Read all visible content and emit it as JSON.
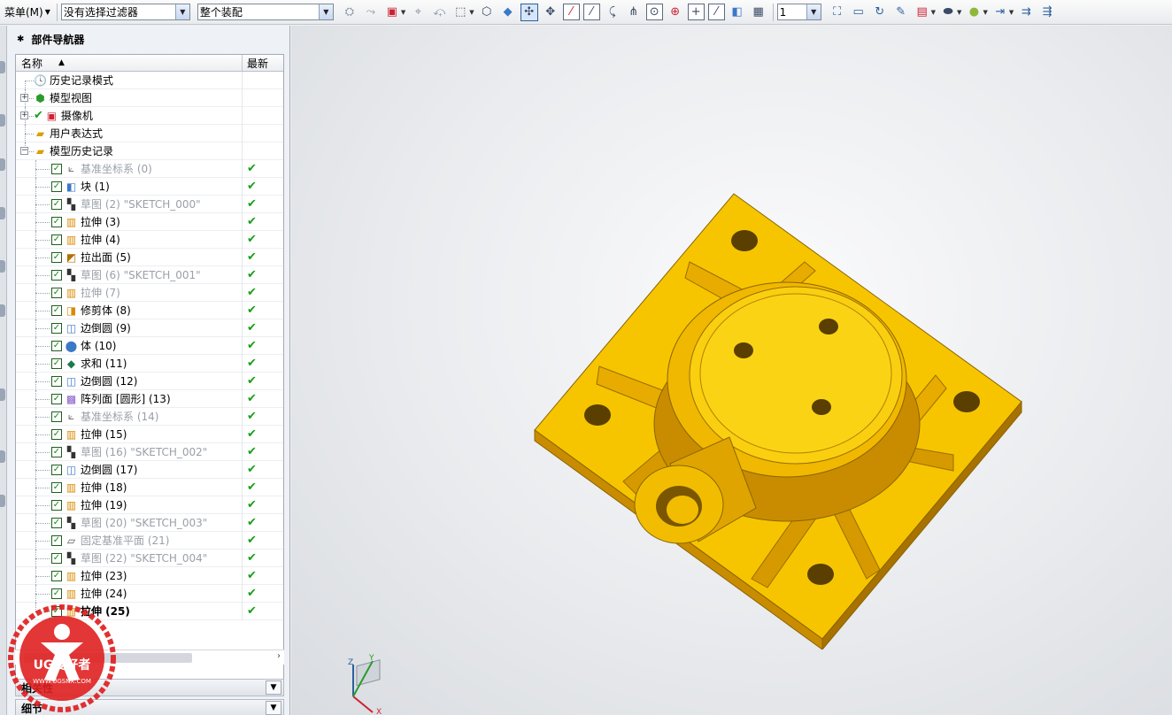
{
  "toolbar": {
    "menu_label": "菜单(M)",
    "selection_filter": "没有选择过滤器",
    "assembly_scope": "整个装配",
    "layer_value": "1"
  },
  "navigator": {
    "title": "部件导航器",
    "columns": {
      "name": "名称",
      "latest": "最新"
    },
    "nodes": [
      {
        "label": "历史记录模式",
        "icon": "clock-icon"
      },
      {
        "label": "模型视图",
        "icon": "model-view-icon"
      },
      {
        "label": "摄像机",
        "icon": "camera-icon"
      },
      {
        "label": "用户表达式",
        "icon": "folder-icon"
      },
      {
        "label": "模型历史记录",
        "icon": "folder-open-icon"
      }
    ],
    "features": [
      {
        "label": "基准坐标系 (0)",
        "icon": "datum-csys-icon",
        "dim": true
      },
      {
        "label": "块 (1)",
        "icon": "block-icon",
        "dim": false
      },
      {
        "label": "草图 (2) \"SKETCH_000\"",
        "icon": "sketch-icon",
        "dim": true
      },
      {
        "label": "拉伸 (3)",
        "icon": "extrude-icon",
        "dim": false
      },
      {
        "label": "拉伸 (4)",
        "icon": "extrude-icon",
        "dim": false
      },
      {
        "label": "拉出面 (5)",
        "icon": "pull-face-icon",
        "dim": false
      },
      {
        "label": "草图 (6) \"SKETCH_001\"",
        "icon": "sketch-icon",
        "dim": true
      },
      {
        "label": "拉伸 (7)",
        "icon": "extrude-icon",
        "dim": true
      },
      {
        "label": "修剪体 (8)",
        "icon": "trim-body-icon",
        "dim": false
      },
      {
        "label": "边倒圆 (9)",
        "icon": "edge-blend-icon",
        "dim": false
      },
      {
        "label": "体 (10)",
        "icon": "body-icon",
        "dim": false
      },
      {
        "label": "求和 (11)",
        "icon": "unite-icon",
        "dim": false
      },
      {
        "label": "边倒圆 (12)",
        "icon": "edge-blend-icon",
        "dim": false
      },
      {
        "label": "阵列面 [圆形] (13)",
        "icon": "pattern-face-icon",
        "dim": false
      },
      {
        "label": "基准坐标系 (14)",
        "icon": "datum-csys-icon",
        "dim": true
      },
      {
        "label": "拉伸 (15)",
        "icon": "extrude-icon",
        "dim": false
      },
      {
        "label": "草图 (16) \"SKETCH_002\"",
        "icon": "sketch-icon",
        "dim": true
      },
      {
        "label": "边倒圆 (17)",
        "icon": "edge-blend-icon",
        "dim": false
      },
      {
        "label": "拉伸 (18)",
        "icon": "extrude-icon",
        "dim": false
      },
      {
        "label": "拉伸 (19)",
        "icon": "extrude-icon",
        "dim": false
      },
      {
        "label": "草图 (20) \"SKETCH_003\"",
        "icon": "sketch-icon",
        "dim": true
      },
      {
        "label": "固定基准平面 (21)",
        "icon": "datum-plane-icon",
        "dim": true
      },
      {
        "label": "草图 (22) \"SKETCH_004\"",
        "icon": "sketch-icon",
        "dim": true
      },
      {
        "label": "拉伸 (23)",
        "icon": "extrude-icon",
        "dim": false
      },
      {
        "label": "拉伸 (24)",
        "icon": "extrude-icon",
        "dim": false
      },
      {
        "label": "拉伸 (25)",
        "icon": "extrude-icon",
        "dim": false,
        "bold": true
      }
    ],
    "panels": {
      "dependencies": "相关性",
      "details": "细节"
    }
  },
  "watermark": {
    "brand": "UG爱好者",
    "url": "WWW.UGSNX.COM"
  },
  "triad": {
    "x": "X",
    "y": "Y",
    "z": "Z"
  },
  "colors": {
    "part": "#f5c400",
    "part_shadow": "#d69a00",
    "check_green": "#16a016"
  }
}
